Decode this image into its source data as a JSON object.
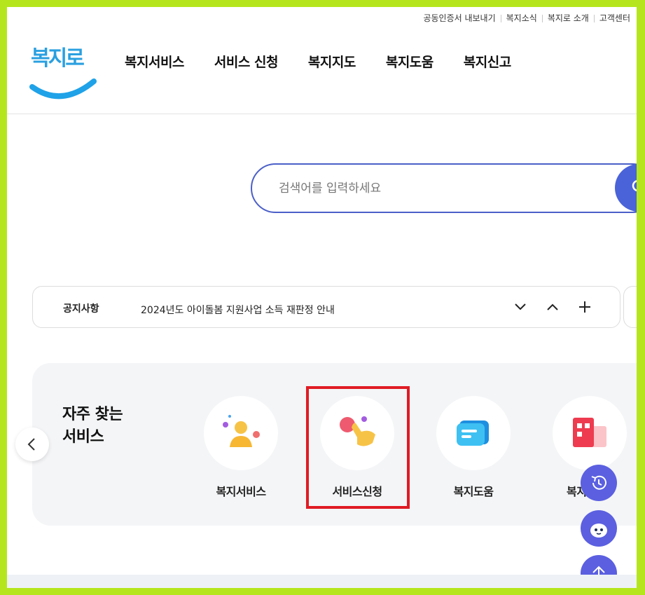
{
  "header": {
    "util_links": [
      "공동인증서 내보내기",
      "복지소식",
      "복지로 소개",
      "고객센터"
    ],
    "logo_text": "복지로",
    "nav": [
      "복지서비스",
      "서비스 신청",
      "복지지도",
      "복지도움",
      "복지신고"
    ]
  },
  "search": {
    "placeholder": "검색어를 입력하세요",
    "value": ""
  },
  "notice": {
    "label": "공지사항",
    "text": "2024년도 아이돌봄 지원사업 소득 재판정 안내"
  },
  "frequent": {
    "title_line1": "자주 찾는",
    "title_line2": "서비스",
    "items": [
      {
        "label": "복지서비스",
        "icon": "person-icon"
      },
      {
        "label": "서비스신청",
        "icon": "tap-hand-icon"
      },
      {
        "label": "복지도움",
        "icon": "chat-bubble-icon"
      },
      {
        "label": "복지",
        "icon": "grid-building-icon"
      }
    ]
  },
  "colors": {
    "accent": "#4b5fc8",
    "highlight": "#e01b24",
    "fab": "#5b5fe0",
    "frame": "#b5e61d"
  }
}
